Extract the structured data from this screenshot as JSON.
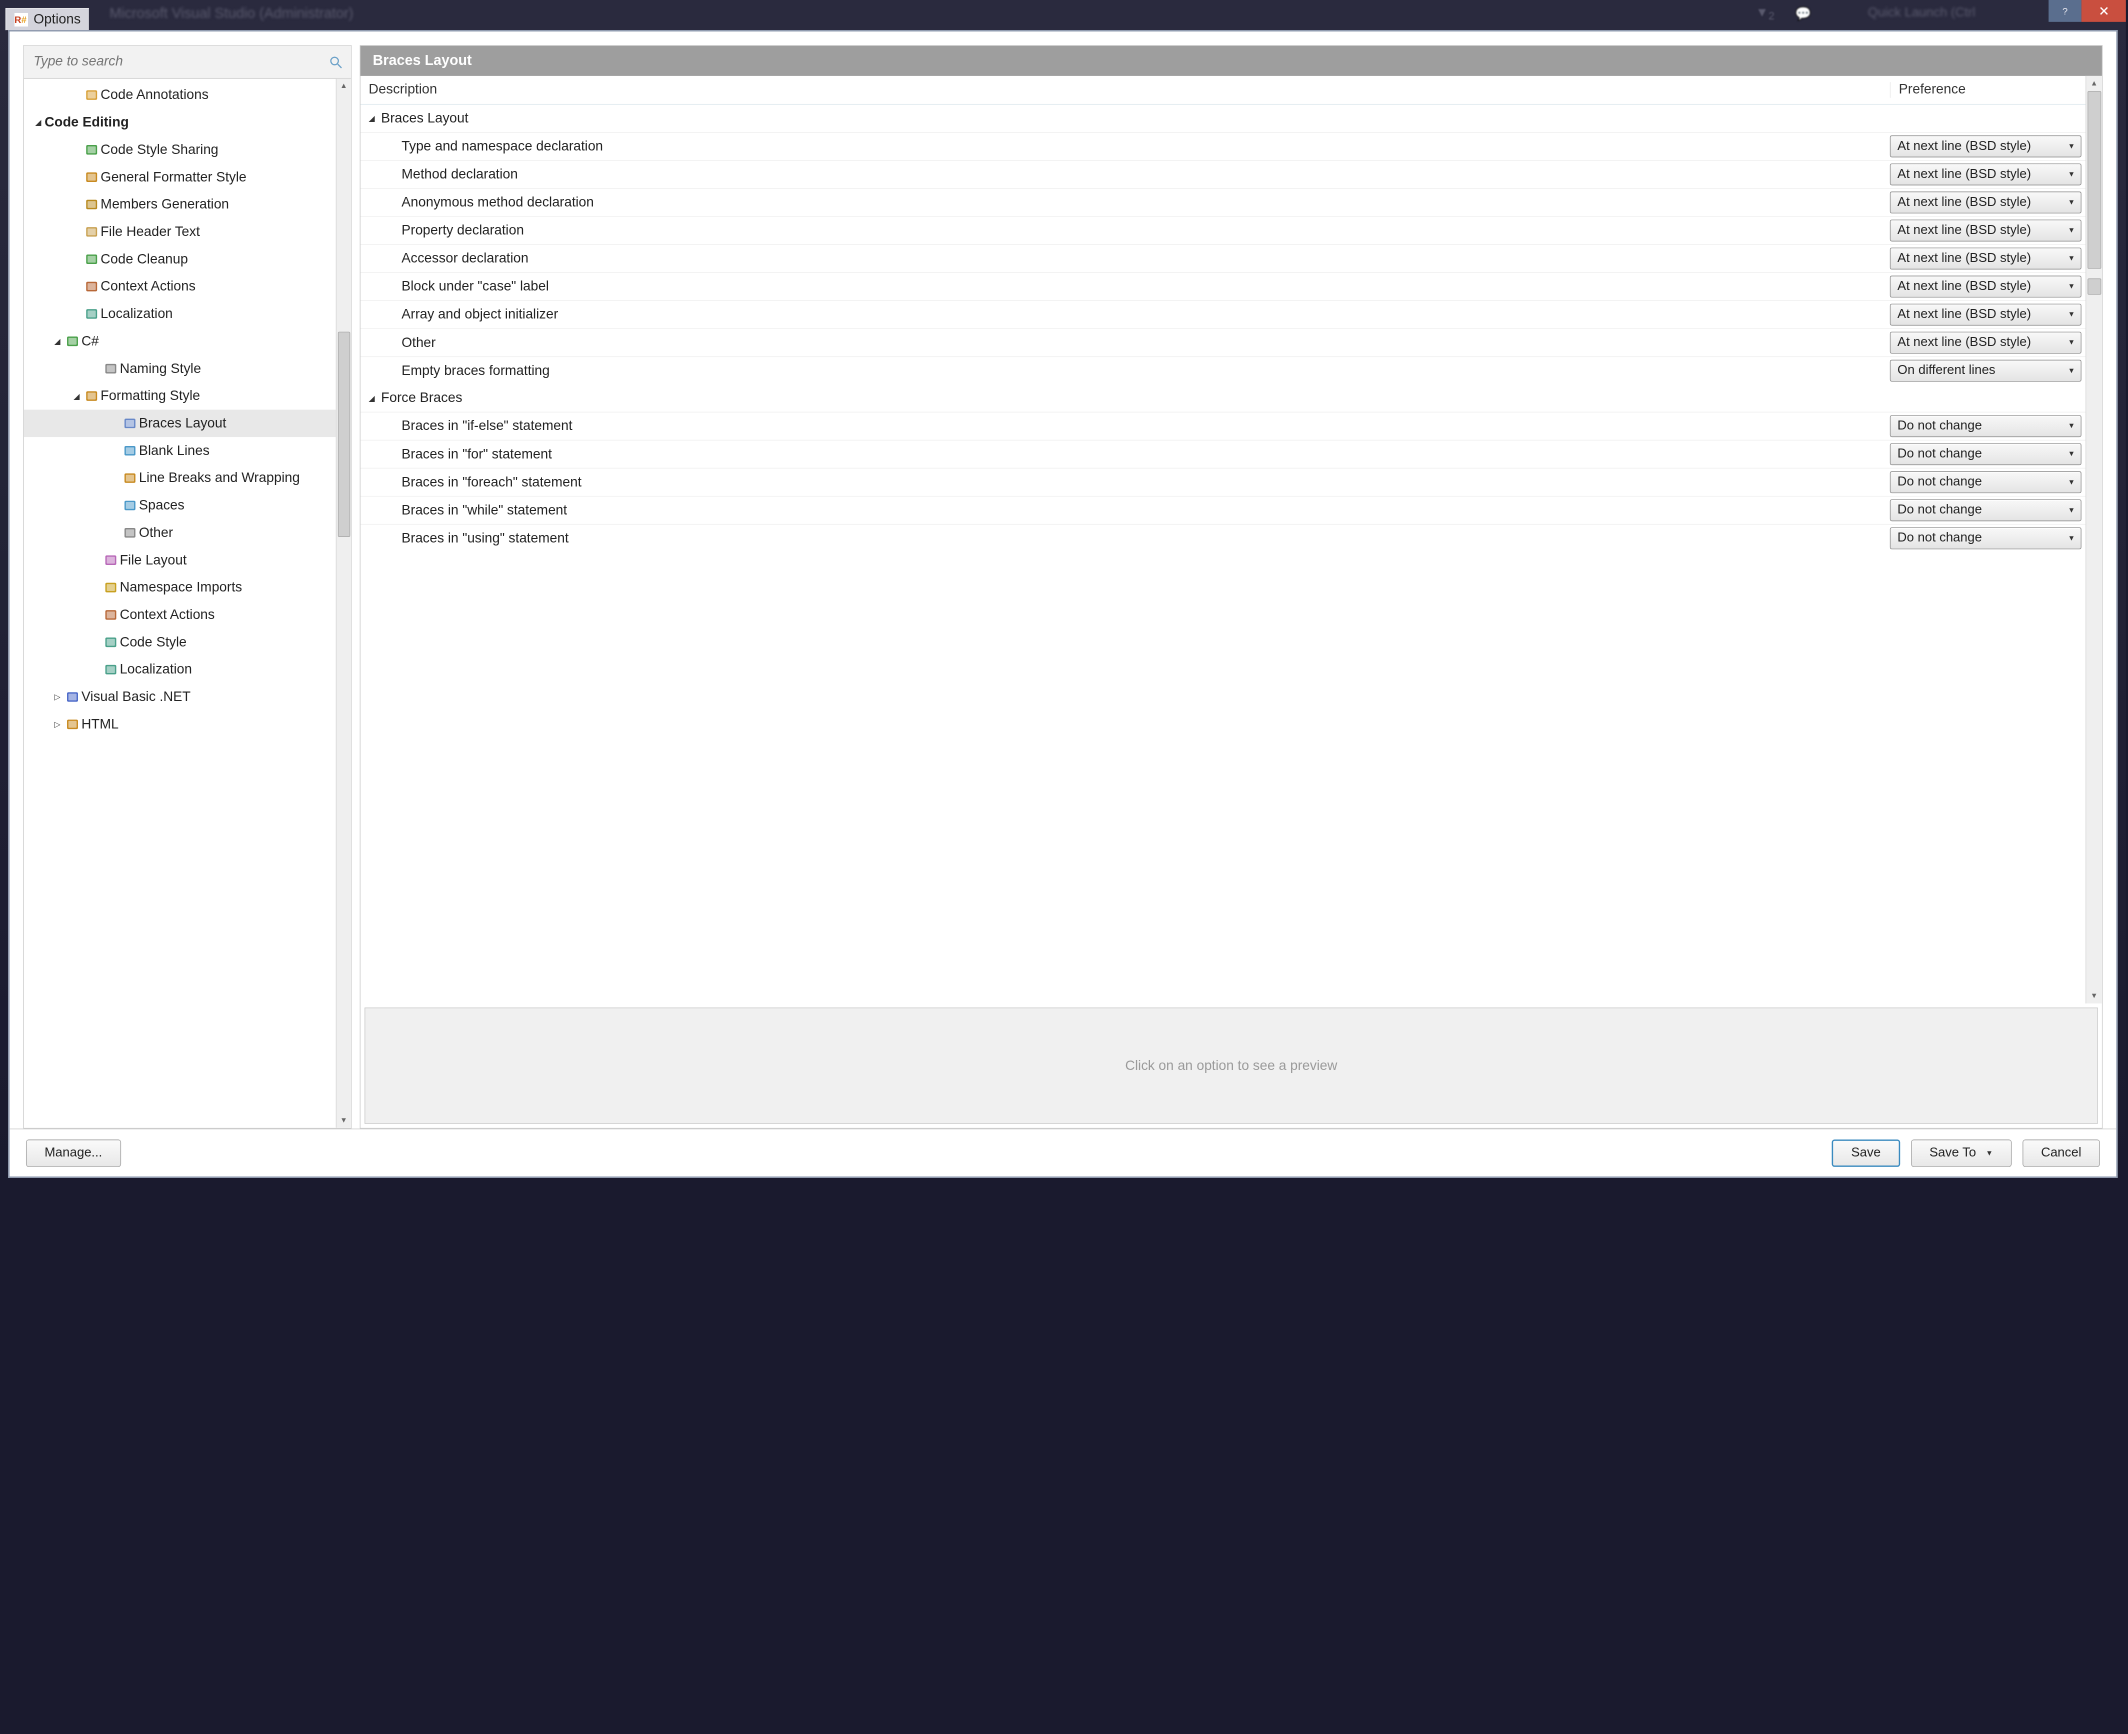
{
  "window": {
    "title_dim": "Microsoft Visual Studio (Administrator)",
    "quicklaunch_dim": "Quick Launch (Ctrl",
    "options_label": "Options"
  },
  "search": {
    "placeholder": "Type to search"
  },
  "tree": {
    "items": [
      {
        "indent": 2,
        "icon": "annotations",
        "label": "Code Annotations"
      },
      {
        "indent": 0,
        "exp": "down",
        "bold": true,
        "label": "Code Editing"
      },
      {
        "indent": 2,
        "icon": "share",
        "label": "Code Style Sharing"
      },
      {
        "indent": 2,
        "icon": "formatter",
        "label": "General Formatter Style"
      },
      {
        "indent": 2,
        "icon": "members",
        "label": "Members Generation"
      },
      {
        "indent": 2,
        "icon": "file",
        "label": "File Header Text"
      },
      {
        "indent": 2,
        "icon": "cleanup",
        "label": "Code Cleanup"
      },
      {
        "indent": 2,
        "icon": "wrench",
        "label": "Context Actions"
      },
      {
        "indent": 2,
        "icon": "loc",
        "label": "Localization"
      },
      {
        "indent": 1,
        "exp": "down",
        "icon": "cs",
        "label": "C#"
      },
      {
        "indent": 3,
        "icon": "aa",
        "label": "Naming Style"
      },
      {
        "indent": 2,
        "exp": "down",
        "icon": "formatter",
        "label": "Formatting Style"
      },
      {
        "indent": 4,
        "icon": "braces",
        "label": "Braces Layout",
        "selected": true
      },
      {
        "indent": 4,
        "icon": "blank",
        "label": "Blank Lines"
      },
      {
        "indent": 4,
        "icon": "wrap",
        "label": "Line Breaks and Wrapping"
      },
      {
        "indent": 4,
        "icon": "spaces",
        "label": "Spaces"
      },
      {
        "indent": 4,
        "icon": "other",
        "label": "Other"
      },
      {
        "indent": 3,
        "icon": "layout",
        "label": "File Layout"
      },
      {
        "indent": 3,
        "icon": "ns",
        "label": "Namespace Imports"
      },
      {
        "indent": 3,
        "icon": "wrench",
        "label": "Context Actions"
      },
      {
        "indent": 3,
        "icon": "style",
        "label": "Code Style"
      },
      {
        "indent": 3,
        "icon": "loc",
        "label": "Localization"
      },
      {
        "indent": 1,
        "exp": "right",
        "icon": "vb",
        "label": "Visual Basic .NET"
      },
      {
        "indent": 1,
        "exp": "right",
        "icon": "html",
        "label": "HTML"
      }
    ]
  },
  "main": {
    "title": "Braces Layout",
    "col_desc": "Description",
    "col_pref": "Preference",
    "groups": [
      {
        "label": "Braces Layout",
        "rows": [
          {
            "desc": "Type and namespace declaration",
            "pref": "At next line (BSD style)"
          },
          {
            "desc": "Method declaration",
            "pref": "At next line (BSD style)"
          },
          {
            "desc": "Anonymous method declaration",
            "pref": "At next line (BSD style)"
          },
          {
            "desc": "Property declaration",
            "pref": "At next line (BSD style)"
          },
          {
            "desc": "Accessor declaration",
            "pref": "At next line (BSD style)"
          },
          {
            "desc": "Block under \"case\" label",
            "pref": "At next line (BSD style)"
          },
          {
            "desc": "Array and object initializer",
            "pref": "At next line (BSD style)"
          },
          {
            "desc": "Other",
            "pref": "At next line (BSD style)"
          },
          {
            "desc": "Empty braces formatting",
            "pref": "On different lines"
          }
        ]
      },
      {
        "label": "Force Braces",
        "rows": [
          {
            "desc": "Braces in \"if-else\" statement",
            "pref": "Do not change"
          },
          {
            "desc": "Braces in \"for\" statement",
            "pref": "Do not change"
          },
          {
            "desc": "Braces in \"foreach\" statement",
            "pref": "Do not change"
          },
          {
            "desc": "Braces in \"while\" statement",
            "pref": "Do not change"
          },
          {
            "desc": "Braces in \"using\" statement",
            "pref": "Do not change"
          }
        ]
      }
    ],
    "preview_hint": "Click on an option to see a preview"
  },
  "footer": {
    "manage": "Manage...",
    "save": "Save",
    "save_to": "Save To",
    "cancel": "Cancel"
  },
  "icons": {
    "annotations": "#d8a038",
    "share": "#4aa04a",
    "formatter": "#c88a20",
    "members": "#b88a20",
    "file": "#c8a050",
    "cleanup": "#4aa04a",
    "wrench": "#b86838",
    "loc": "#4aa08a",
    "cs": "#4aa04a",
    "aa": "#888888",
    "braces": "#6888c8",
    "blank": "#4a98c8",
    "wrap": "#c88a20",
    "spaces": "#4a98c8",
    "other": "#888888",
    "layout": "#b868b8",
    "ns": "#c8a020",
    "style": "#4aa08a",
    "vb": "#4a68c8",
    "html": "#c88a20"
  }
}
